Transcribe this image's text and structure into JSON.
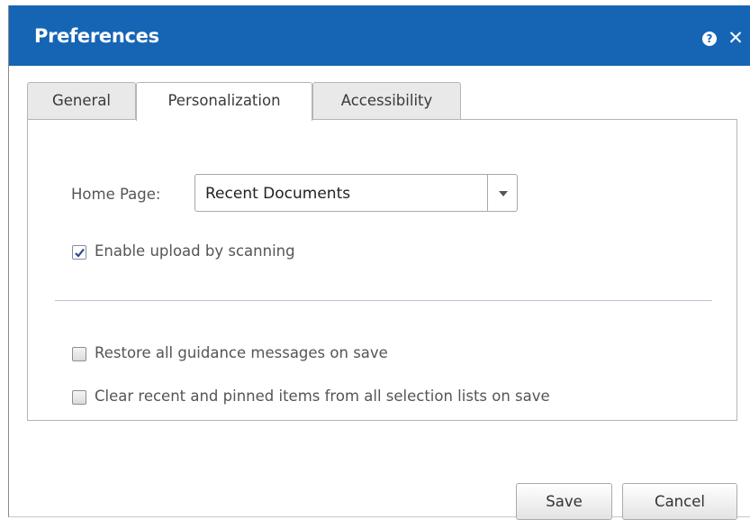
{
  "dialog": {
    "title": "Preferences",
    "help_icon": "help-icon",
    "close_icon": "close-icon",
    "help_glyph": "?",
    "close_glyph": "✕",
    "accent_color": "#1665b5"
  },
  "tabs": [
    {
      "label": "General",
      "active": false
    },
    {
      "label": "Personalization",
      "active": true
    },
    {
      "label": "Accessibility",
      "active": false
    }
  ],
  "personalization": {
    "home_page_label": "Home Page:",
    "home_page_value": "Recent Documents",
    "enable_scanning_label": "Enable upload by scanning",
    "enable_scanning_checked": true,
    "restore_guidance_label": "Restore all guidance messages on save",
    "restore_guidance_checked": false,
    "clear_recent_label": "Clear recent and pinned items from all selection lists on save",
    "clear_recent_checked": false
  },
  "footer": {
    "save_label": "Save",
    "cancel_label": "Cancel"
  }
}
